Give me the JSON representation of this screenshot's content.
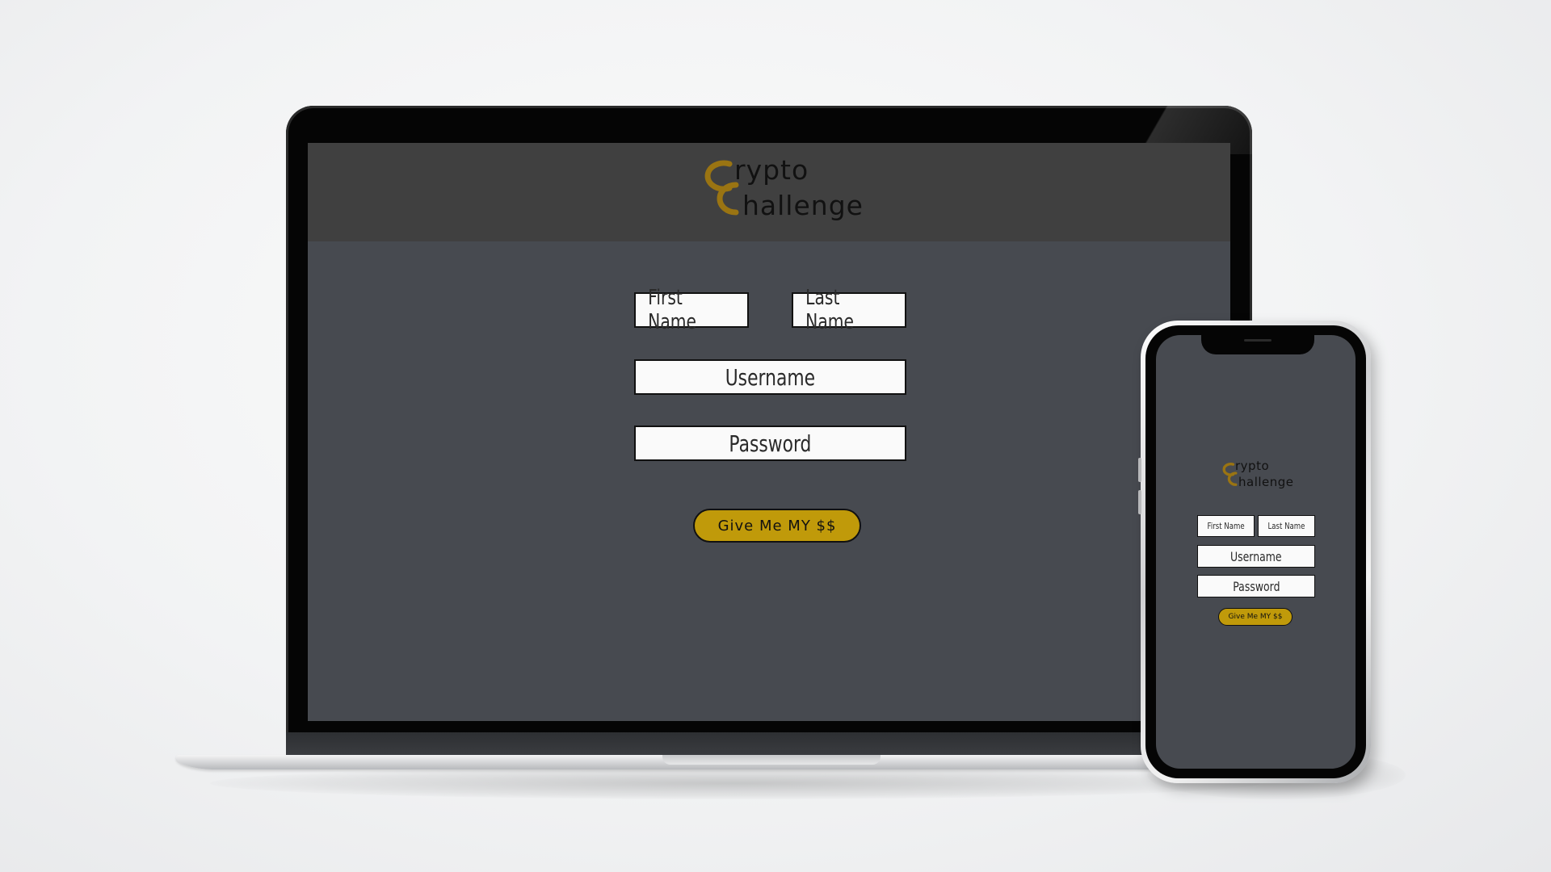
{
  "app": {
    "logo": {
      "line1": "rypto",
      "line2": "hallenge",
      "mark": "cc-monogram-icon"
    },
    "form": {
      "first_name_placeholder": "First Name",
      "last_name_placeholder": "Last Name",
      "username_placeholder": "Username",
      "password_placeholder": "Password",
      "submit_label": "Give Me MY $$"
    }
  },
  "colors": {
    "background": "#f2f3f4",
    "app_header": "#404040",
    "app_body": "#474a50",
    "accent_gold": "#c09a0a",
    "logo_gold": "#9a7412",
    "field_bg": "#fafafa",
    "device_frame": "#050505"
  }
}
